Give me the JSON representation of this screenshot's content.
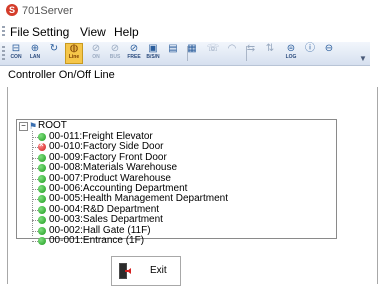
{
  "app": {
    "title": "701Server",
    "logo_letter": "S"
  },
  "menu": [
    "File",
    "Setting",
    "View",
    "Help"
  ],
  "toolbar": [
    {
      "label": "CON",
      "icon": "connect-icon",
      "glyph": "⊟"
    },
    {
      "label": "LAN",
      "icon": "lan-icon",
      "glyph": "⊕"
    },
    {
      "label": "",
      "icon": "refresh-icon",
      "glyph": "↻"
    },
    {
      "label": "Line",
      "icon": "line-icon",
      "glyph": "◍",
      "active": true
    },
    {
      "label": "ON",
      "icon": "door-on-icon",
      "glyph": "⊘",
      "dim": true
    },
    {
      "label": "BUS",
      "icon": "bus-icon",
      "glyph": "⊘",
      "dim": true
    },
    {
      "label": "FREE",
      "icon": "free-icon",
      "glyph": "⊘"
    },
    {
      "label": "B/S/N",
      "icon": "bsn-icon",
      "glyph": "▣"
    },
    {
      "label": "",
      "icon": "card-icon",
      "glyph": "▤"
    },
    {
      "label": "",
      "icon": "list-icon",
      "glyph": "▦"
    },
    {
      "label": "",
      "icon": "phone-icon",
      "glyph": "☏",
      "dim": true
    },
    {
      "label": "",
      "icon": "wifi-icon",
      "glyph": "◠",
      "dim": true
    },
    {
      "label": "",
      "icon": "transfer-icon",
      "glyph": "⇆",
      "dim": true
    },
    {
      "label": "",
      "icon": "sort-icon",
      "glyph": "⇅",
      "dim": true
    },
    {
      "label": "LOG",
      "icon": "log-icon",
      "glyph": "⊜"
    },
    {
      "label": "",
      "icon": "info-icon",
      "glyph": "ⓘ"
    },
    {
      "label": "",
      "icon": "exit-toolbar-icon",
      "glyph": "⊖"
    }
  ],
  "panel": {
    "title": "Controller On/Off Line",
    "root": "ROOT",
    "items": [
      {
        "label": "00-011:Freight Elevator",
        "status": "online"
      },
      {
        "label": "00-010:Factory Side Door",
        "status": "offline"
      },
      {
        "label": "00-009:Factory Front Door",
        "status": "online"
      },
      {
        "label": "00-008:Materials Warehouse",
        "status": "online"
      },
      {
        "label": "00-007:Product Warehouse",
        "status": "online"
      },
      {
        "label": "00-006:Accounting Department",
        "status": "online"
      },
      {
        "label": "00-005:Health Management Department",
        "status": "online"
      },
      {
        "label": "00-004:R&D Department",
        "status": "online"
      },
      {
        "label": "00-003:Sales Department",
        "status": "online"
      },
      {
        "label": "00-002:Hall Gate (11F)",
        "status": "online"
      },
      {
        "label": "00-001:Entrance (1F)",
        "status": "online"
      }
    ],
    "exit_label": "Exit"
  },
  "colors": {
    "online": "#1e9a1e",
    "offline": "#cc1a1a",
    "active_tool": "#f5c64a"
  }
}
